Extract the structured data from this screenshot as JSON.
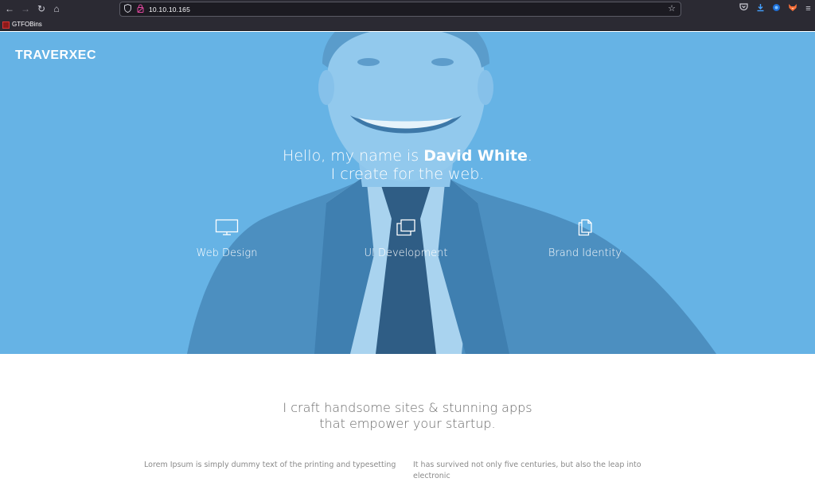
{
  "browser": {
    "url": "10.10.10.165",
    "bookmark_label": "GTFOBins"
  },
  "icons": {
    "back": "arrow-left-icon",
    "forward": "arrow-right-icon",
    "reload": "reload-icon",
    "home": "home-icon",
    "shield": "shield-icon",
    "lock": "lock-icon",
    "star": "star-icon",
    "pocket": "pocket-icon",
    "download": "download-icon",
    "extension1": "extension-icon",
    "extension2": "fox-icon",
    "menu": "hamburger-menu-icon"
  },
  "site": {
    "brand": "TRAVERXEC",
    "hero_line1_prefix": "Hello, my name is ",
    "hero_name": "David White",
    "hero_line1_suffix": ".",
    "hero_line2": "I create for the web.",
    "services": [
      {
        "label": "Web Design",
        "icon": "monitor-icon"
      },
      {
        "label": "UI Development",
        "icon": "layers-icon"
      },
      {
        "label": "Brand Identity",
        "icon": "document-icon"
      }
    ],
    "tagline_line1": "I craft handsome sites & stunning apps",
    "tagline_line2": "that empower your startup.",
    "para_left": "Lorem Ipsum is simply dummy text of the printing and typesetting",
    "para_right": "It has survived not only five centuries, but also the leap into electronic"
  },
  "colors": {
    "hero_overlay": "#64b1e3",
    "chrome": "#2b2a33"
  }
}
